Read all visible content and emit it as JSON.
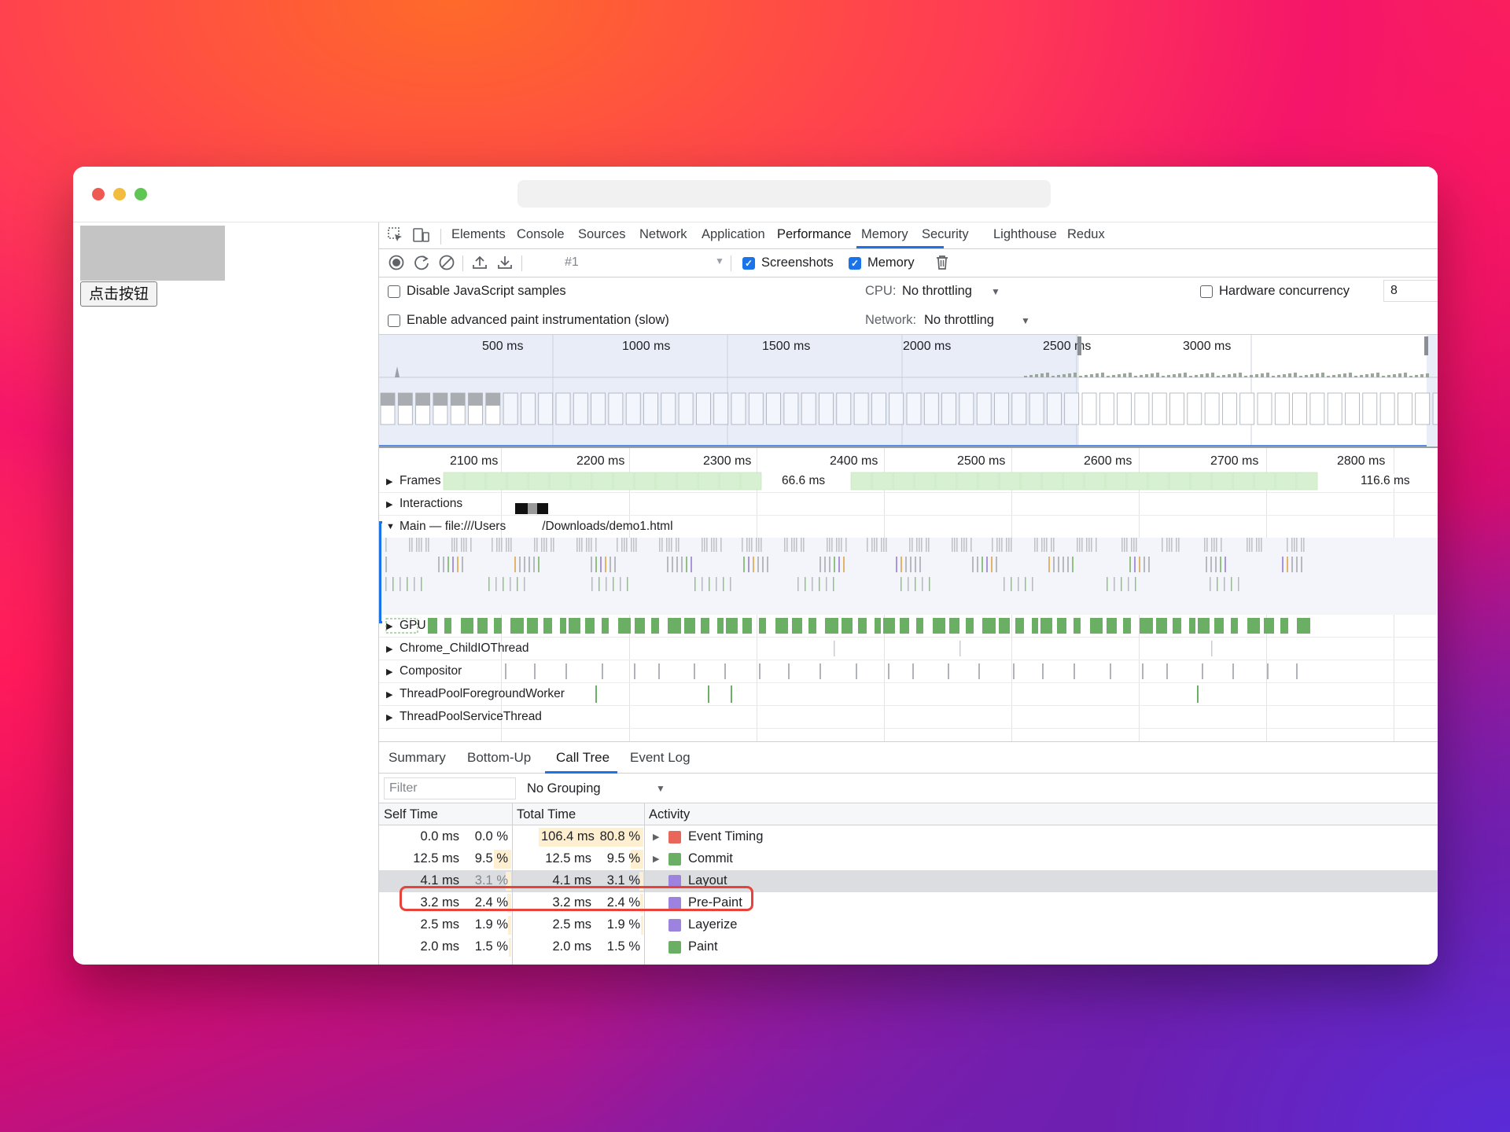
{
  "page": {
    "button_label": "点击按钮"
  },
  "devtools": {
    "tabs": [
      "Elements",
      "Console",
      "Sources",
      "Network",
      "Application",
      "Performance",
      "Memory",
      "Security",
      "Lighthouse",
      "Redux"
    ],
    "active_tab": "Performance",
    "toolbar": {
      "profile_selector": "#1",
      "screenshots_label": "Screenshots",
      "screenshots_checked": true,
      "memory_label": "Memory",
      "memory_checked": true
    },
    "settings": {
      "disable_js_samples": "Disable JavaScript samples",
      "advanced_paint": "Enable advanced paint instrumentation (slow)",
      "cpu_label": "CPU:",
      "cpu_value": "No throttling",
      "network_label": "Network:",
      "network_value": "No throttling",
      "hw_concurrency_label": "Hardware concurrency",
      "hw_concurrency_value": "8"
    },
    "overview_ticks": [
      "500 ms",
      "1000 ms",
      "1500 ms",
      "2000 ms",
      "2500 ms",
      "3000 ms"
    ],
    "timeline_ticks": [
      "2100 ms",
      "2200 ms",
      "2300 ms",
      "2400 ms",
      "2500 ms",
      "2600 ms",
      "2700 ms",
      "2800 ms"
    ],
    "frames": {
      "label": "Frames",
      "frame_a": "66.6 ms",
      "frame_b": "116.6 ms"
    },
    "tracks": {
      "interactions": "Interactions",
      "main_prefix": "Main — file:///Users",
      "main_suffix": "/Downloads/demo1.html",
      "gpu": "GPU",
      "child_io": "Chrome_ChildIOThread",
      "compositor": "Compositor",
      "fg_worker": "ThreadPoolForegroundWorker",
      "service_thread": "ThreadPoolServiceThread"
    },
    "bottom_tabs": [
      "Summary",
      "Bottom-Up",
      "Call Tree",
      "Event Log"
    ],
    "active_bottom_tab": "Call Tree",
    "filter_placeholder": "Filter",
    "grouping": "No Grouping",
    "columns": {
      "self": "Self Time",
      "total": "Total Time",
      "activity": "Activity"
    },
    "rows": [
      {
        "self_ms": "0.0 ms",
        "self_pct": "0.0 %",
        "total_ms": "106.4 ms",
        "total_pct": "80.8 %",
        "activity": "Event Timing",
        "color": "#e8675a",
        "expandable": true
      },
      {
        "self_ms": "12.5 ms",
        "self_pct": "9.5 %",
        "total_ms": "12.5 ms",
        "total_pct": "9.5 %",
        "activity": "Commit",
        "color": "#6aaf63",
        "expandable": true
      },
      {
        "self_ms": "4.1 ms",
        "self_pct": "3.1 %",
        "total_ms": "4.1 ms",
        "total_pct": "3.1 %",
        "activity": "Layout",
        "color": "#9d82e0",
        "expandable": false
      },
      {
        "self_ms": "3.2 ms",
        "self_pct": "2.4 %",
        "total_ms": "3.2 ms",
        "total_pct": "2.4 %",
        "activity": "Pre-Paint",
        "color": "#9d82e0",
        "expandable": false
      },
      {
        "self_ms": "2.5 ms",
        "self_pct": "1.9 %",
        "total_ms": "2.5 ms",
        "total_pct": "1.9 %",
        "activity": "Layerize",
        "color": "#9d82e0",
        "expandable": false
      },
      {
        "self_ms": "2.0 ms",
        "self_pct": "1.5 %",
        "total_ms": "2.0 ms",
        "total_pct": "1.5 %",
        "activity": "Paint",
        "color": "#6aaf63",
        "expandable": false
      }
    ],
    "selected_row": 2
  }
}
